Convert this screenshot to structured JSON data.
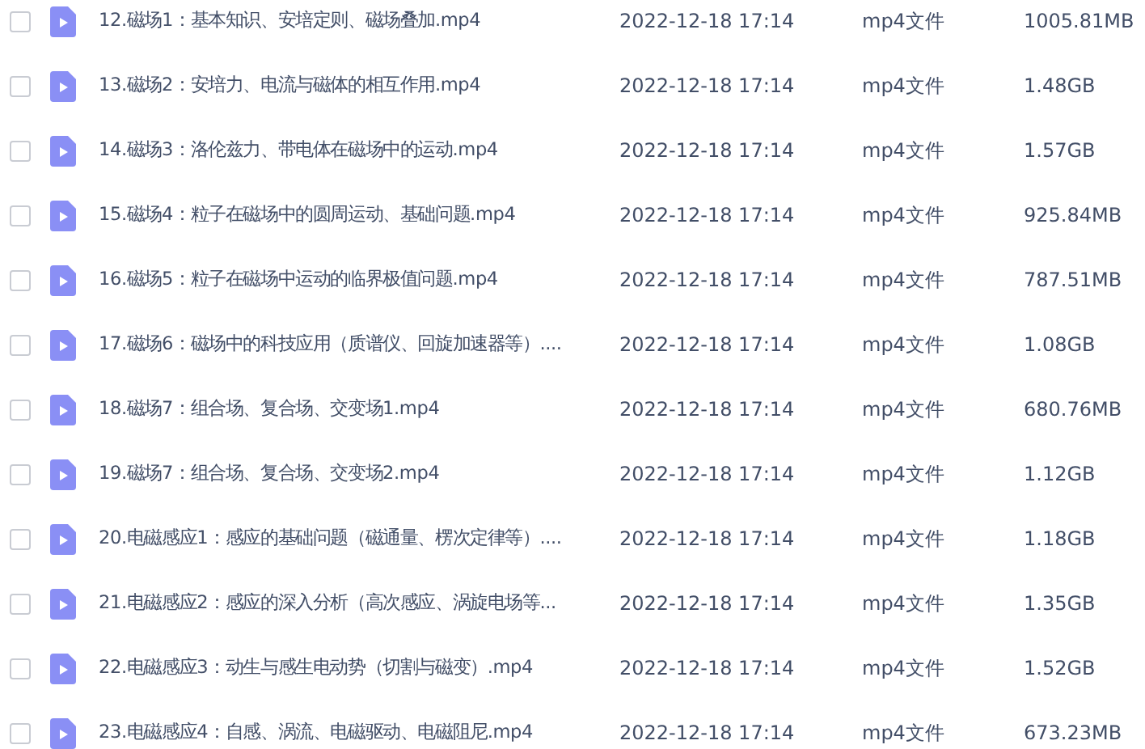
{
  "files": [
    {
      "name": "12.磁场1：基本知识、安培定则、磁场叠加.mp4",
      "modified": "2022-12-18 17:14",
      "type": "mp4文件",
      "size": "1005.81MB",
      "checked": false
    },
    {
      "name": "13.磁场2：安培力、电流与磁体的相互作用.mp4",
      "modified": "2022-12-18 17:14",
      "type": "mp4文件",
      "size": "1.48GB",
      "checked": false
    },
    {
      "name": "14.磁场3：洛伦兹力、带电体在磁场中的运动.mp4",
      "modified": "2022-12-18 17:14",
      "type": "mp4文件",
      "size": "1.57GB",
      "checked": false
    },
    {
      "name": "15.磁场4：粒子在磁场中的圆周运动、基础问题.mp4",
      "modified": "2022-12-18 17:14",
      "type": "mp4文件",
      "size": "925.84MB",
      "checked": false
    },
    {
      "name": "16.磁场5：粒子在磁场中运动的临界极值问题.mp4",
      "modified": "2022-12-18 17:14",
      "type": "mp4文件",
      "size": "787.51MB",
      "checked": false
    },
    {
      "name": "17.磁场6：磁场中的科技应用（质谱仪、回旋加速器等）....",
      "modified": "2022-12-18 17:14",
      "type": "mp4文件",
      "size": "1.08GB",
      "checked": false
    },
    {
      "name": "18.磁场7：组合场、复合场、交变场1.mp4",
      "modified": "2022-12-18 17:14",
      "type": "mp4文件",
      "size": "680.76MB",
      "checked": false
    },
    {
      "name": "19.磁场7：组合场、复合场、交变场2.mp4",
      "modified": "2022-12-18 17:14",
      "type": "mp4文件",
      "size": "1.12GB",
      "checked": false
    },
    {
      "name": "20.电磁感应1：感应的基础问题（磁通量、楞次定律等）....",
      "modified": "2022-12-18 17:14",
      "type": "mp4文件",
      "size": "1.18GB",
      "checked": false
    },
    {
      "name": "21.电磁感应2：感应的深入分析（高次感应、涡旋电场等...",
      "modified": "2022-12-18 17:14",
      "type": "mp4文件",
      "size": "1.35GB",
      "checked": false
    },
    {
      "name": "22.电磁感应3：动生与感生电动势（切割与磁变）.mp4",
      "modified": "2022-12-18 17:14",
      "type": "mp4文件",
      "size": "1.52GB",
      "checked": false
    },
    {
      "name": "23.电磁感应4：自感、涡流、电磁驱动、电磁阻尼.mp4",
      "modified": "2022-12-18 17:14",
      "type": "mp4文件",
      "size": "673.23MB",
      "checked": false
    }
  ]
}
